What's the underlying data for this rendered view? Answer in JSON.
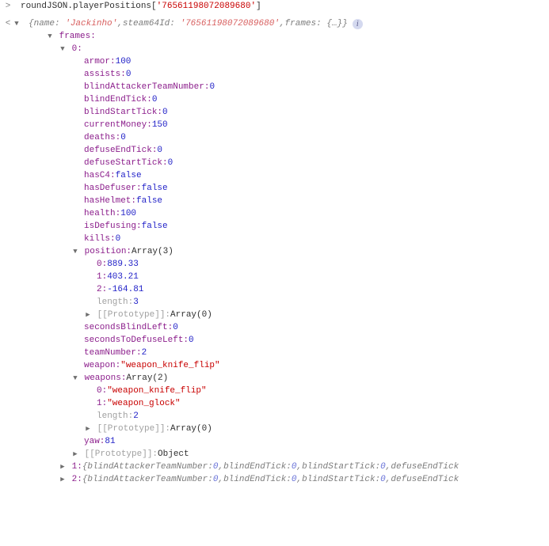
{
  "input": {
    "object": "roundJSON.playerPositions",
    "bracket_open": "[",
    "key_quoted": "'76561198072089680'",
    "bracket_close": "]"
  },
  "result_summary": {
    "open": "{",
    "name_k": "name:",
    "name_v": "'Jackinho'",
    "sep1": ", ",
    "steam_k": "steam64Id:",
    "steam_v": "'76561198072089680'",
    "sep2": ", ",
    "frames_k": "frames:",
    "frames_v": "{…}",
    "close": "}"
  },
  "frames_label": "frames:",
  "frame0_label": "0:",
  "frame0_props": {
    "armor": {
      "k": "armor: ",
      "v": "100",
      "t": "num"
    },
    "assists": {
      "k": "assists: ",
      "v": "0",
      "t": "num"
    },
    "batn": {
      "k": "blindAttackerTeamNumber: ",
      "v": "0",
      "t": "num"
    },
    "bet": {
      "k": "blindEndTick: ",
      "v": "0",
      "t": "num"
    },
    "bst": {
      "k": "blindStartTick: ",
      "v": "0",
      "t": "num"
    },
    "money": {
      "k": "currentMoney: ",
      "v": "150",
      "t": "num"
    },
    "deaths": {
      "k": "deaths: ",
      "v": "0",
      "t": "num"
    },
    "det": {
      "k": "defuseEndTick: ",
      "v": "0",
      "t": "num"
    },
    "dst": {
      "k": "defuseStartTick: ",
      "v": "0",
      "t": "num"
    },
    "hasC4": {
      "k": "hasC4: ",
      "v": "false",
      "t": "bool"
    },
    "hasDef": {
      "k": "hasDefuser: ",
      "v": "false",
      "t": "bool"
    },
    "hasHel": {
      "k": "hasHelmet: ",
      "v": "false",
      "t": "bool"
    },
    "health": {
      "k": "health: ",
      "v": "100",
      "t": "num"
    },
    "isDef": {
      "k": "isDefusing: ",
      "v": "false",
      "t": "bool"
    },
    "kills": {
      "k": "kills: ",
      "v": "0",
      "t": "num"
    }
  },
  "position": {
    "hdr_k": "position: ",
    "hdr_v": "Array(3)",
    "i0": {
      "k": "0: ",
      "v": "889.33"
    },
    "i1": {
      "k": "1: ",
      "v": "403.21"
    },
    "i2": {
      "k": "2: ",
      "v": "-164.81"
    },
    "len": {
      "k": "length: ",
      "v": "3"
    },
    "proto": {
      "k": "[[Prototype]]: ",
      "v": "Array(0)"
    }
  },
  "after_pos": {
    "sbl": {
      "k": "secondsBlindLeft: ",
      "v": "0",
      "t": "num"
    },
    "sdl": {
      "k": "secondsToDefuseLeft: ",
      "v": "0",
      "t": "num"
    },
    "team": {
      "k": "teamNumber: ",
      "v": "2",
      "t": "num"
    },
    "weapon": {
      "k": "weapon: ",
      "v": "\"weapon_knife_flip\"",
      "t": "str"
    }
  },
  "weapons": {
    "hdr_k": "weapons: ",
    "hdr_v": "Array(2)",
    "i0": {
      "k": "0: ",
      "v": "\"weapon_knife_flip\""
    },
    "i1": {
      "k": "1: ",
      "v": "\"weapon_glock\""
    },
    "len": {
      "k": "length: ",
      "v": "2"
    },
    "proto": {
      "k": "[[Prototype]]: ",
      "v": "Array(0)"
    }
  },
  "yaw": {
    "k": "yaw: ",
    "v": "81",
    "t": "num"
  },
  "frame0_proto": {
    "k": "[[Prototype]]: ",
    "v": "Object"
  },
  "frame1": {
    "idx": "1: ",
    "open": "{",
    "p1k": "blindAttackerTeamNumber: ",
    "p1v": "0",
    "s1": ", ",
    "p2k": "blindEndTick: ",
    "p2v": "0",
    "s2": ", ",
    "p3k": "blindStartTick: ",
    "p3v": "0",
    "s3": ", ",
    "p4k": "defuseEndTick"
  },
  "frame2": {
    "idx": "2: ",
    "open": "{",
    "p1k": "blindAttackerTeamNumber: ",
    "p1v": "0",
    "s1": ", ",
    "p2k": "blindEndTick: ",
    "p2v": "0",
    "s2": ", ",
    "p3k": "blindStartTick: ",
    "p3v": "0",
    "s3": ", ",
    "p4k": "defuseEndTick"
  }
}
